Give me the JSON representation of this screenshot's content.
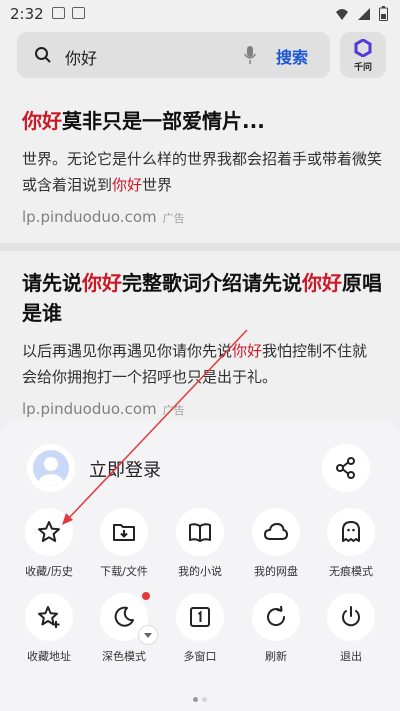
{
  "status": {
    "time": "2:32"
  },
  "search": {
    "query": "你好",
    "button": "搜索",
    "qianwen_label": "千问"
  },
  "results": [
    {
      "title_hl": "你好",
      "title_rest": "莫非只是一部爱情片...",
      "desc_1": "世界。无论它是什么样的世界我都会招着手或带着微笑或含着泪说到",
      "desc_hl": "你好",
      "desc_2": "世界",
      "url": "lp.pinduoduo.com",
      "ad": "广告"
    },
    {
      "title_1": "请先说",
      "title_hl_1": "你好",
      "title_2": "完整歌词介绍请先说",
      "title_hl_2": "你好",
      "title_3": "原唱是谁",
      "desc_1": "以后再遇见你再遇见你请你先说",
      "desc_hl": "你好",
      "desc_2": "我怕控制不住就会给你拥抱打一个招呼也只是出于礼。",
      "url": "lp.pinduoduo.com",
      "ad": "广告"
    }
  ],
  "sheet": {
    "login": "立即登录",
    "items": [
      {
        "label": "收藏/历史",
        "icon": "star-icon"
      },
      {
        "label": "下载/文件",
        "icon": "download-folder-icon"
      },
      {
        "label": "我的小说",
        "icon": "book-icon"
      },
      {
        "label": "我的网盘",
        "icon": "cloud-icon"
      },
      {
        "label": "无痕模式",
        "icon": "ghost-icon"
      },
      {
        "label": "收藏地址",
        "icon": "star-plus-icon"
      },
      {
        "label": "深色模式",
        "icon": "moon-icon"
      },
      {
        "label": "多窗口",
        "icon": "window-icon"
      },
      {
        "label": "刷新",
        "icon": "refresh-icon"
      },
      {
        "label": "退出",
        "icon": "power-icon"
      }
    ]
  },
  "colors": {
    "accent": "#1f5fe0",
    "highlight": "#d81b2b",
    "annotation": "#e0393e"
  }
}
